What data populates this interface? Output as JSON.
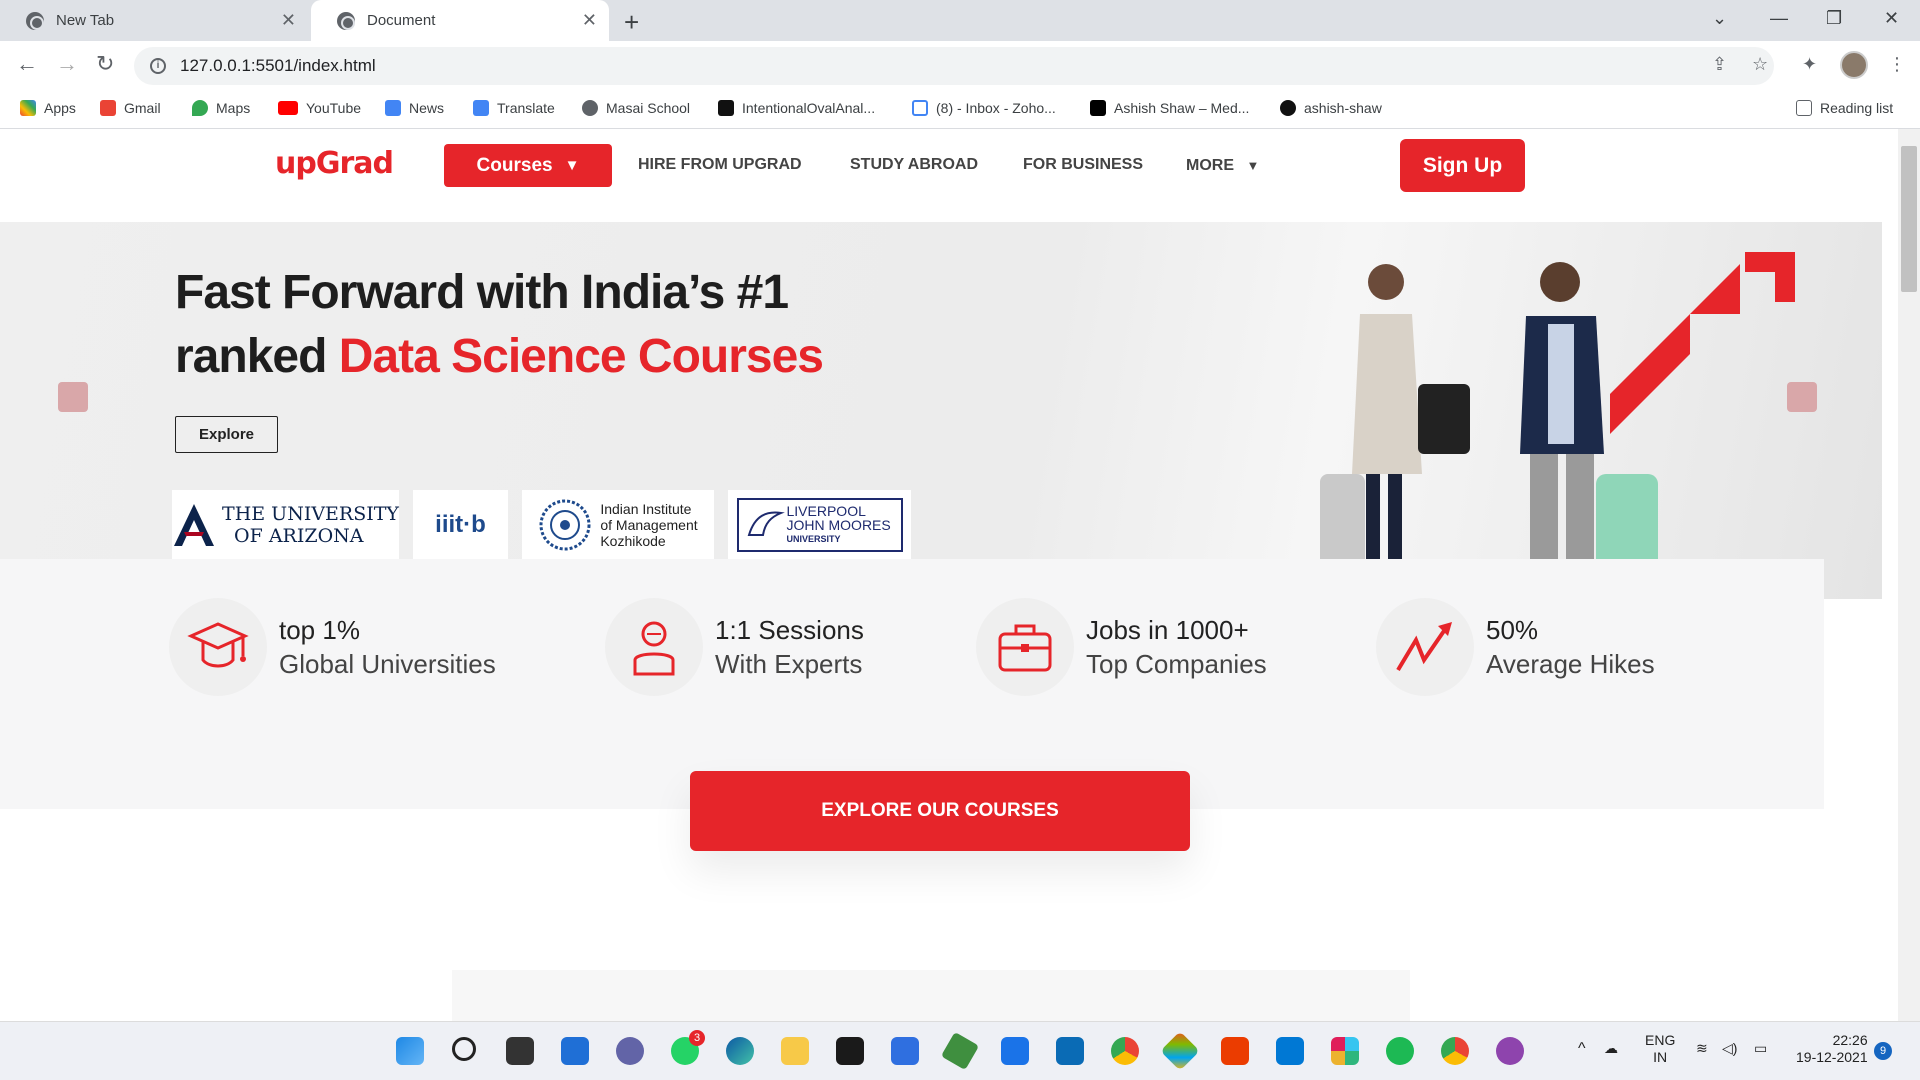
{
  "browser": {
    "tabs": [
      {
        "title": "New Tab"
      },
      {
        "title": "Document"
      }
    ],
    "url": "127.0.0.1:5501/index.html",
    "bookmarks": [
      "Apps",
      "Gmail",
      "Maps",
      "YouTube",
      "News",
      "Translate",
      "Masai School",
      "IntentionalOvalAnal...",
      "(8) - Inbox - Zoho...",
      "Ashish Shaw – Med...",
      "ashish-shaw"
    ],
    "reading_list": "Reading list"
  },
  "nav": {
    "logo": "upGrad",
    "courses": "Courses",
    "links": [
      "HIRE FROM UPGRAD",
      "STUDY ABROAD",
      "FOR BUSINESS",
      "MORE"
    ],
    "signup": "Sign Up"
  },
  "hero": {
    "line1": "Fast Forward with India’s #1",
    "line2_prefix": "ranked ",
    "line2_highlight": "Data Science Courses",
    "explore": "Explore",
    "universities": {
      "arizona_1": "THE UNIVERSITY",
      "arizona_2": "OF ARIZONA",
      "iiitb": "iiit·b",
      "iimk_1": "Indian Institute",
      "iimk_2": "of Management",
      "iimk_3": "Kozhikode",
      "ljmu_1": "LIVERPOOL",
      "ljmu_2": "JOHN MOORES",
      "ljmu_3": "UNIVERSITY"
    }
  },
  "features": [
    {
      "line1": "top 1%",
      "line2": "Global Universities",
      "icon": "graduation-cap-icon"
    },
    {
      "line1": "1:1 Sessions",
      "line2": "With Experts",
      "icon": "expert-icon"
    },
    {
      "line1": "Jobs in 1000+",
      "line2": "Top Companies",
      "icon": "briefcase-icon"
    },
    {
      "line1": "50%",
      "line2": "Average Hikes",
      "icon": "trend-up-icon"
    }
  ],
  "explore_courses": "EXPLORE OUR COURSES",
  "taskbar": {
    "lang1": "ENG",
    "lang2": "IN",
    "time": "22:26",
    "date": "19-12-2021",
    "notif_count": "9",
    "whatsapp_badge": "3"
  },
  "colors": {
    "brand": "#e6252a"
  }
}
